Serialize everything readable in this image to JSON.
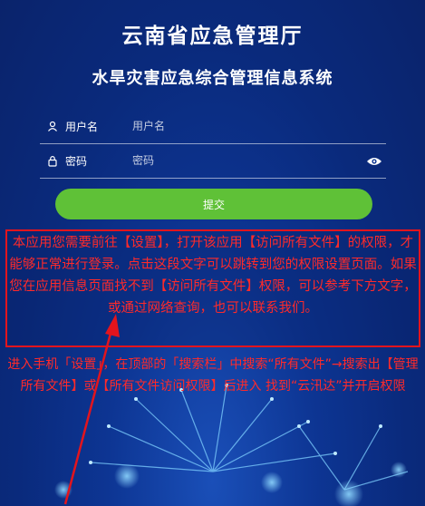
{
  "header": {
    "org_title": "云南省应急管理厅",
    "system_title": "水旱灾害应急综合管理信息系统"
  },
  "login": {
    "username": {
      "label": "用户名",
      "placeholder": "用户名",
      "icon": "user-icon"
    },
    "password": {
      "label": "密码",
      "placeholder": "密码",
      "icon": "lock-icon",
      "toggle_icon": "eye-icon"
    },
    "submit_label": "提交"
  },
  "notice": {
    "text": "本应用您需要前往【设置】，打开该应用【访问所有文件】的权限，才能够正常进行登录。点击这段文字可以跳转到您的权限设置页面。如果您在应用信息页面找不到【访问所有文件】权限，可以参考下方文字，或通过网络查询，也可以联系我们。"
  },
  "hint": {
    "text": "进入手机「设置」，在顶部的「搜索栏」中搜索“所有文件”→搜索出【管理所有文件】或【所有文件访问权限】后进入 找到“云汛达”并开启权限"
  },
  "colors": {
    "background": "#0d3593",
    "submit": "#5fc137",
    "warning": "#ff2a2a",
    "box_border": "#e3141d"
  }
}
